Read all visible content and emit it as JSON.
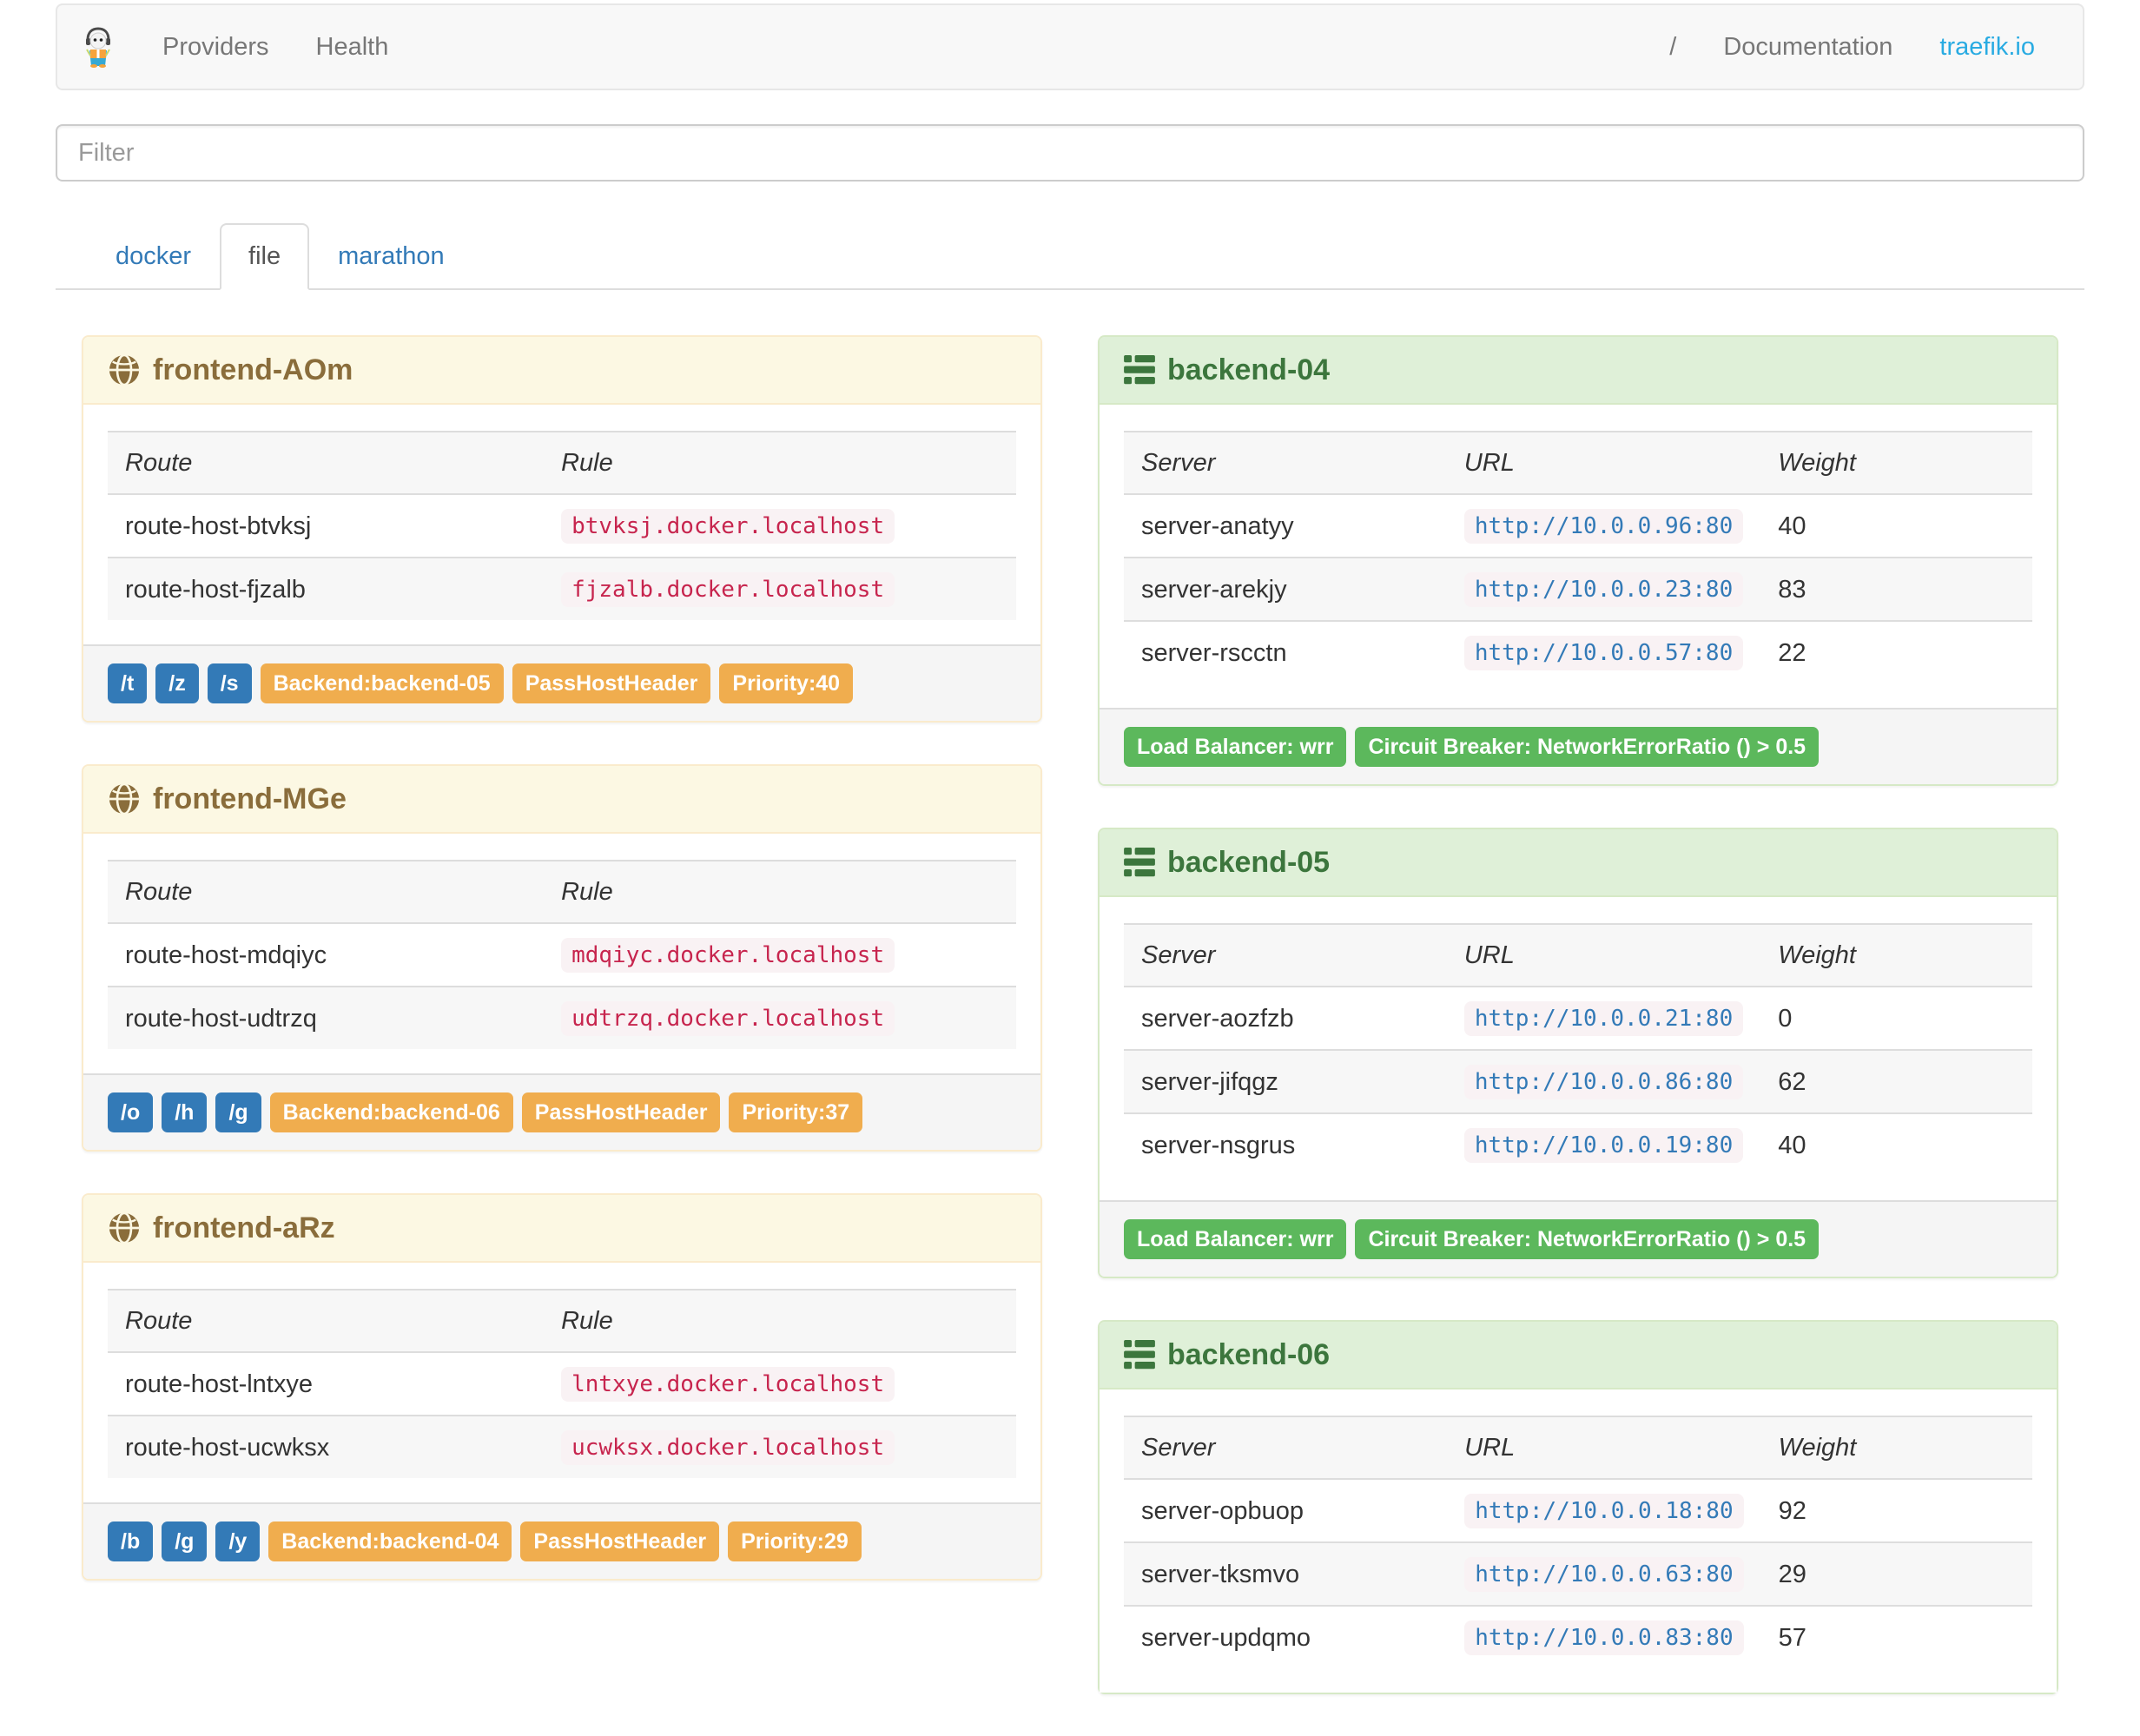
{
  "navbar": {
    "brand_icon": "traefik-logo",
    "links": {
      "providers": "Providers",
      "health": "Health"
    },
    "right": {
      "slash": "/",
      "documentation": "Documentation",
      "site": "traefik.io"
    }
  },
  "filter": {
    "placeholder": "Filter"
  },
  "tabs": {
    "docker": "docker",
    "file": "file",
    "marathon": "marathon",
    "active": "file"
  },
  "frontend_columns": {
    "route": "Route",
    "rule": "Rule"
  },
  "backend_columns": {
    "server": "Server",
    "url": "URL",
    "weight": "Weight"
  },
  "frontends": [
    {
      "title": "frontend-AOm",
      "rows": [
        {
          "route": "route-host-btvksj",
          "rule": "btvksj.docker.localhost"
        },
        {
          "route": "route-host-fjzalb",
          "rule": "fjzalb.docker.localhost"
        }
      ],
      "path_labels": [
        "/t",
        "/z",
        "/s"
      ],
      "backend_label": "Backend:backend-05",
      "pass_host_header": "PassHostHeader",
      "priority": "Priority:40"
    },
    {
      "title": "frontend-MGe",
      "rows": [
        {
          "route": "route-host-mdqiyc",
          "rule": "mdqiyc.docker.localhost"
        },
        {
          "route": "route-host-udtrzq",
          "rule": "udtrzq.docker.localhost"
        }
      ],
      "path_labels": [
        "/o",
        "/h",
        "/g"
      ],
      "backend_label": "Backend:backend-06",
      "pass_host_header": "PassHostHeader",
      "priority": "Priority:37"
    },
    {
      "title": "frontend-aRz",
      "rows": [
        {
          "route": "route-host-lntxye",
          "rule": "lntxye.docker.localhost"
        },
        {
          "route": "route-host-ucwksx",
          "rule": "ucwksx.docker.localhost"
        }
      ],
      "path_labels": [
        "/b",
        "/g",
        "/y"
      ],
      "backend_label": "Backend:backend-04",
      "pass_host_header": "PassHostHeader",
      "priority": "Priority:29"
    }
  ],
  "backends": [
    {
      "title": "backend-04",
      "rows": [
        {
          "server": "server-anatyy",
          "url": "http://10.0.0.96:80",
          "weight": "40"
        },
        {
          "server": "server-arekjy",
          "url": "http://10.0.0.23:80",
          "weight": "83"
        },
        {
          "server": "server-rscctn",
          "url": "http://10.0.0.57:80",
          "weight": "22"
        }
      ],
      "load_balancer": "Load Balancer: wrr",
      "circuit_breaker": "Circuit Breaker: NetworkErrorRatio () > 0.5"
    },
    {
      "title": "backend-05",
      "rows": [
        {
          "server": "server-aozfzb",
          "url": "http://10.0.0.21:80",
          "weight": "0"
        },
        {
          "server": "server-jifqgz",
          "url": "http://10.0.0.86:80",
          "weight": "62"
        },
        {
          "server": "server-nsgrus",
          "url": "http://10.0.0.19:80",
          "weight": "40"
        }
      ],
      "load_balancer": "Load Balancer: wrr",
      "circuit_breaker": "Circuit Breaker: NetworkErrorRatio () > 0.5"
    },
    {
      "title": "backend-06",
      "rows": [
        {
          "server": "server-opbuop",
          "url": "http://10.0.0.18:80",
          "weight": "92"
        },
        {
          "server": "server-tksmvo",
          "url": "http://10.0.0.63:80",
          "weight": "29"
        },
        {
          "server": "server-updqmo",
          "url": "http://10.0.0.83:80",
          "weight": "57"
        }
      ]
    }
  ],
  "colors": {
    "brand_link": "#29abe2",
    "link_blue": "#337ab7",
    "label_primary": "#337ab7",
    "label_warning": "#f0ad4e",
    "label_success": "#5cb85c",
    "frontend_header_bg": "#fcf8e3",
    "frontend_header_text": "#8a6d3b",
    "backend_header_bg": "#dff0d8",
    "backend_header_text": "#3c763d",
    "code_text": "#c7254e",
    "code_bg": "#f9f2f4",
    "navbar_bg": "#f8f8f8"
  }
}
